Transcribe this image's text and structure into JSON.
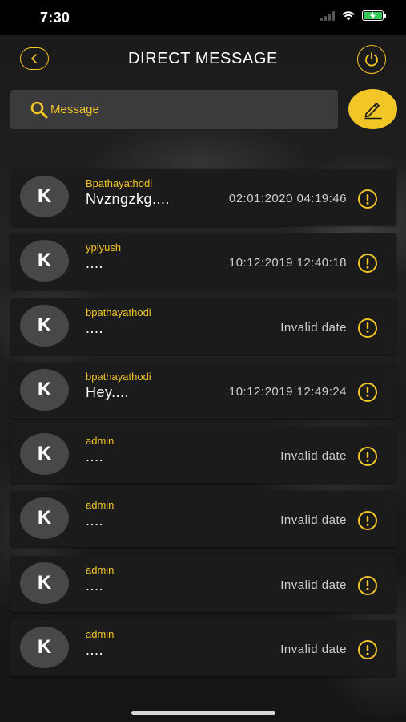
{
  "status_bar": {
    "time": "7:30"
  },
  "header": {
    "title": "DIRECT MESSAGE"
  },
  "search": {
    "placeholder": "Message"
  },
  "colors": {
    "accent": "#f2c627",
    "card": "#1b1b1b",
    "avatar": "#484848",
    "search_bg": "#3b3b3b"
  },
  "icons": {
    "back": "chevron-left-icon",
    "power": "power-icon",
    "search": "search-icon",
    "compose": "pencil-icon",
    "alert": "exclamation-circle-icon"
  },
  "messages": [
    {
      "avatar": "K",
      "sender": "Bpathayathodi",
      "preview": "Nvzngzkg....",
      "time": "02:01:2020 04:19:46"
    },
    {
      "avatar": "K",
      "sender": "ypiyush",
      "preview": "....",
      "time": "10:12:2019 12:40:18"
    },
    {
      "avatar": "K",
      "sender": "bpathayathodi",
      "preview": "....",
      "time": "Invalid date"
    },
    {
      "avatar": "K",
      "sender": "bpathayathodi",
      "preview": "Hey....",
      "time": "10:12:2019 12:49:24"
    },
    {
      "avatar": "K",
      "sender": "admin",
      "preview": "....",
      "time": "Invalid date"
    },
    {
      "avatar": "K",
      "sender": "admin",
      "preview": "....",
      "time": "Invalid date"
    },
    {
      "avatar": "K",
      "sender": "admin",
      "preview": "....",
      "time": "Invalid date"
    },
    {
      "avatar": "K",
      "sender": "admin",
      "preview": "....",
      "time": "Invalid date"
    }
  ]
}
